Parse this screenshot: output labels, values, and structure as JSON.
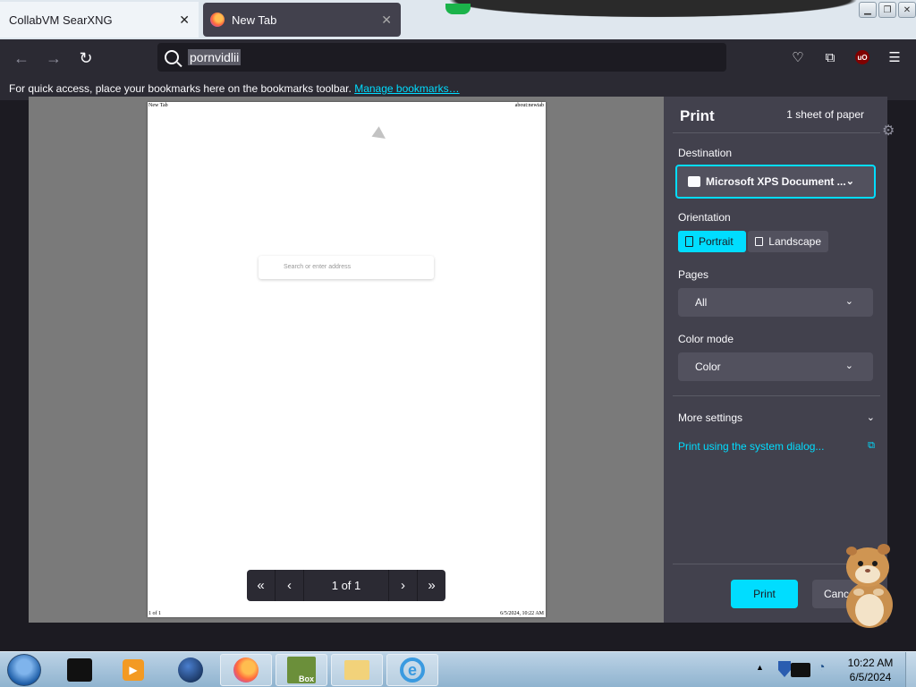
{
  "browser": {
    "tabs": [
      {
        "title": "CollabVM SearXNG",
        "close": "✕"
      },
      {
        "title": "New Tab",
        "close": "✕"
      }
    ],
    "url_value": "pornvidlii",
    "bookmarks_hint": "For quick access, place your bookmarks here on the bookmarks toolbar.",
    "bookmarks_link": "Manage bookmarks…"
  },
  "preview": {
    "header_left": "New Tab",
    "header_right": "about:newtab",
    "footer_left": "1 of 1",
    "footer_right": "6/5/2024, 10:22 AM",
    "search_placeholder": "Search or enter address",
    "pager_label": "1 of 1"
  },
  "print_panel": {
    "title": "Print",
    "sheets": "1 sheet of paper",
    "destination_label": "Destination",
    "destination_value": "Microsoft XPS Document ...",
    "orientation_label": "Orientation",
    "portrait": "Portrait",
    "landscape": "Landscape",
    "pages_label": "Pages",
    "pages_value": "All",
    "color_mode_label": "Color mode",
    "color_mode_value": "Color",
    "more_settings": "More settings",
    "system_dialog": "Print using the system dialog...",
    "print_button": "Print",
    "cancel_button": "Cancel"
  },
  "taskbar": {
    "time": "10:22 AM",
    "date": "6/5/2024",
    "box_label": "Box"
  },
  "colors": {
    "accent": "#00ddff",
    "panel_bg": "#42414d",
    "chrome_bg": "#2b2a33"
  }
}
